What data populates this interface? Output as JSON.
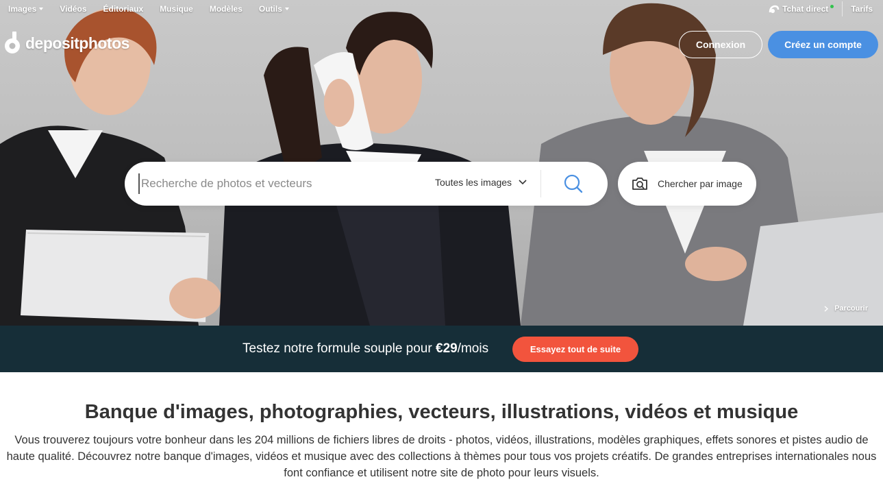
{
  "nav": {
    "items": [
      {
        "label": "Images",
        "dropdown": true
      },
      {
        "label": "Vidéos",
        "dropdown": false
      },
      {
        "label": "Éditoriaux",
        "dropdown": false
      },
      {
        "label": "Musique",
        "dropdown": false
      },
      {
        "label": "Modèles",
        "dropdown": false
      },
      {
        "label": "Outils",
        "dropdown": true
      }
    ],
    "chat_label": "Tchat direct",
    "pricing_label": "Tarifs"
  },
  "logo": {
    "text": "depositphotos"
  },
  "auth": {
    "login_label": "Connexion",
    "signup_label": "Créez un compte"
  },
  "search": {
    "placeholder": "Recherche de photos et vecteurs",
    "type_selected": "Toutes les images",
    "image_search_label": "Chercher par image"
  },
  "hero": {
    "browse_label": "Parcourir"
  },
  "promo": {
    "text_before": "Testez notre formule souple pour ",
    "price": "€29",
    "text_after": "/mois",
    "button_label": "Essayez tout de suite"
  },
  "content": {
    "title": "Banque d'images, photographies, vecteurs, illustrations, vidéos et musique",
    "description": "Vous trouverez toujours votre bonheur dans les 204 millions de fichiers libres de droits - photos, vidéos, illustrations, modèles graphiques, effets sonores et pistes audio de haute qualité. Découvrez notre banque d'images, vidéos et musique avec des collections à thèmes pour tous vos projets créatifs. De grandes entreprises internationales nous font confiance et utilisent notre site de photo pour leurs visuels."
  },
  "colors": {
    "accent_blue": "#4a90e2",
    "promo_bg": "#162e38",
    "promo_button": "#f2543d",
    "online_dot": "#32c24d"
  },
  "icons": {
    "search": "search-icon",
    "camera": "camera-icon",
    "chevron": "chevron-down-icon",
    "chat": "chat-icon",
    "logo": "logo-icon",
    "browse": "chevron-right-icon"
  }
}
